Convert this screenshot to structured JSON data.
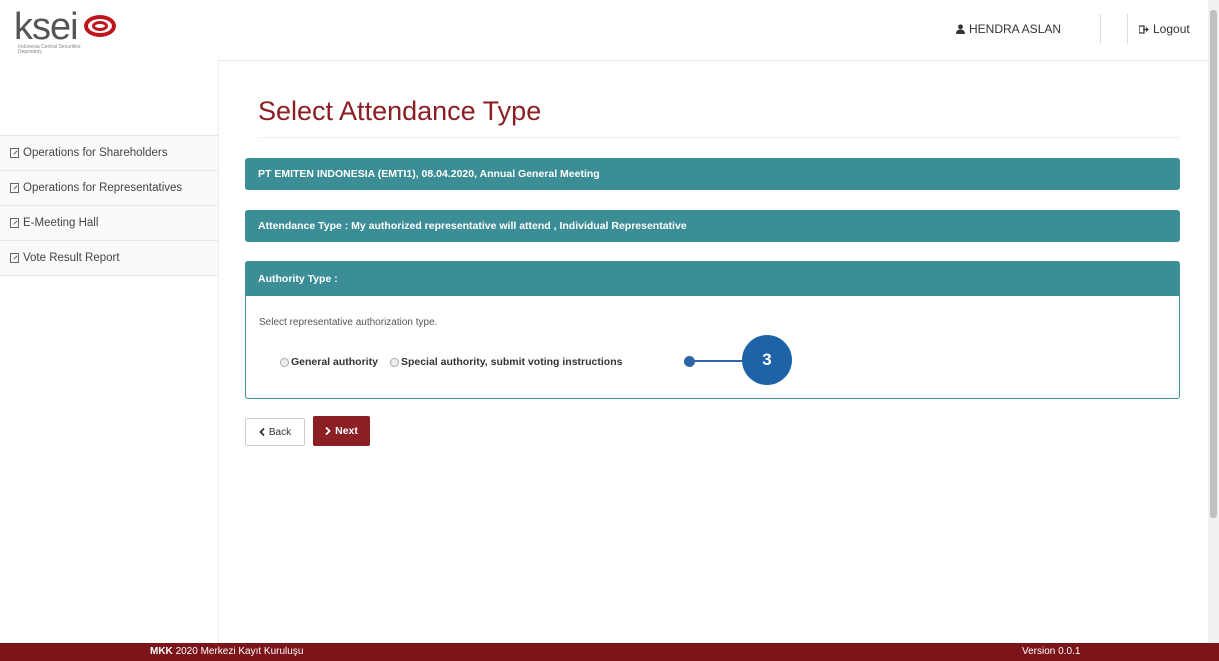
{
  "header": {
    "logo_text": "ksei",
    "logo_subtitle": "Indonesia Central Securities Depository",
    "user_name": "HENDRA ASLAN",
    "logout_label": "Logout"
  },
  "sidebar": {
    "items": [
      {
        "label": "Operations for Shareholders"
      },
      {
        "label": "Operations for Representatives"
      },
      {
        "label": "E-Meeting Hall"
      },
      {
        "label": "Vote Result Report"
      }
    ]
  },
  "main": {
    "title": "Select Attendance Type",
    "meeting_info": "PT EMITEN INDONESIA (EMTI1), 08.04.2020, Annual General Meeting",
    "attendance_type": "Attendance Type : My authorized representative will attend , Individual Representative",
    "authority_panel": {
      "heading": "Authority Type :",
      "instruction": "Select representative authorization type.",
      "options": [
        {
          "label": "General authority"
        },
        {
          "label": "Special authority, submit voting instructions"
        }
      ]
    },
    "annotation_number": "3",
    "back_label": "Back",
    "next_label": "Next"
  },
  "footer": {
    "brand_mark": "MKK",
    "copyright": "2020 Merkezi Kayıt Kuruluşu",
    "version": "Version 0.0.1"
  },
  "colors": {
    "teal": "#3c8e96",
    "maroon": "#8b1f24",
    "footer": "#7c1519",
    "annotation_blue": "#1e62a8"
  }
}
